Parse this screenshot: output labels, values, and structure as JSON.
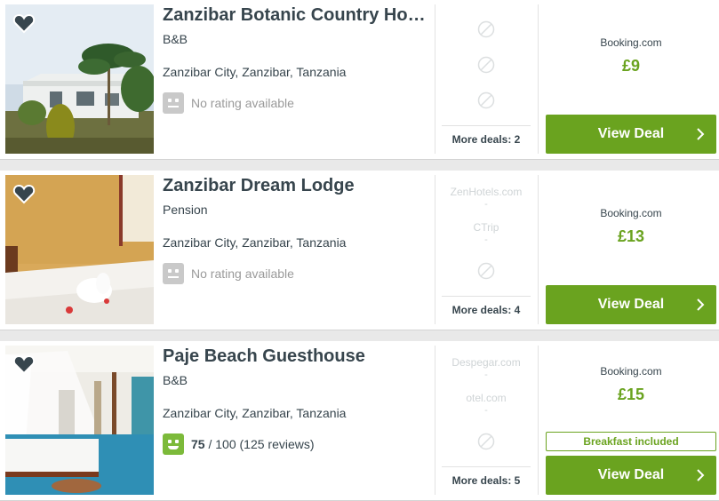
{
  "colors": {
    "accent_green": "#6aa31f",
    "rating_green": "#7cba3a",
    "text": "#37454d",
    "muted": "#9a9a9a"
  },
  "hotels": [
    {
      "name": "Zanzibar Botanic Country House",
      "type": "B&B",
      "location": "Zanzibar City, Zanzibar, Tanzania",
      "rating": {
        "text": "No rating available"
      },
      "image": "white-house-with-palm-trees",
      "other_deals": [],
      "more_deals": "More deals: 2",
      "provider": "Booking.com",
      "price": "£9",
      "extra": null,
      "button": "View Deal"
    },
    {
      "name": "Zanzibar Dream Lodge",
      "type": "Pension",
      "location": "Zanzibar City, Zanzibar, Tanzania",
      "rating": {
        "text": "No rating available"
      },
      "image": "bedroom-with-towel-swan",
      "other_deals": [
        "ZenHotels.com",
        "CTrip"
      ],
      "more_deals": "More deals: 4",
      "provider": "Booking.com",
      "price": "£13",
      "extra": null,
      "button": "View Deal"
    },
    {
      "name": "Paje Beach Guesthouse",
      "type": "B&B",
      "location": "Zanzibar City, Zanzibar, Tanzania",
      "rating": {
        "score": "75",
        "out_of": "/ 100",
        "reviews": "(125 reviews)"
      },
      "image": "bedroom-with-mosquito-net",
      "other_deals": [
        "Despegar.com",
        "otel.com"
      ],
      "more_deals": "More deals: 5",
      "provider": "Booking.com",
      "price": "£15",
      "extra": "Breakfast included",
      "button": "View Deal"
    }
  ],
  "placeholders": {
    "dash": "-"
  }
}
